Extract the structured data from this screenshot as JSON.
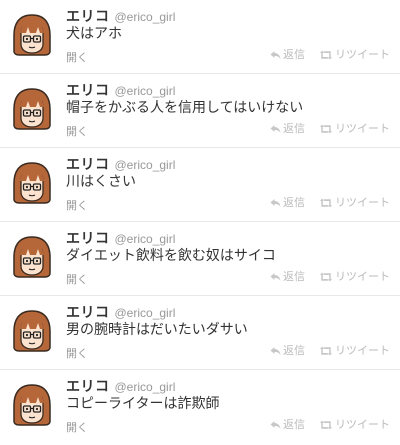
{
  "timeline": {
    "tweets": [
      {
        "name": "エリコ",
        "handle": "@erico_girl",
        "text": "犬はアホ",
        "open_label": "開く",
        "reply_label": "返信",
        "retweet_label": "リツイート"
      },
      {
        "name": "エリコ",
        "handle": "@erico_girl",
        "text": "帽子をかぶる人を信用してはいけない",
        "open_label": "開く",
        "reply_label": "返信",
        "retweet_label": "リツイート"
      },
      {
        "name": "エリコ",
        "handle": "@erico_girl",
        "text": "川はくさい",
        "open_label": "開く",
        "reply_label": "返信",
        "retweet_label": "リツイート"
      },
      {
        "name": "エリコ",
        "handle": "@erico_girl",
        "text": "ダイエット飲料を飲む奴はサイコ",
        "open_label": "開く",
        "reply_label": "返信",
        "retweet_label": "リツイート"
      },
      {
        "name": "エリコ",
        "handle": "@erico_girl",
        "text": "男の腕時計はだいたいダサい",
        "open_label": "開く",
        "reply_label": "返信",
        "retweet_label": "リツイート"
      },
      {
        "name": "エリコ",
        "handle": "@erico_girl",
        "text": "コピーライターは詐欺師",
        "open_label": "開く",
        "reply_label": "返信",
        "retweet_label": "リツイート"
      }
    ]
  },
  "colors": {
    "hair": "#b5673a",
    "skin": "#fbe3cf",
    "muted_text": "#999999",
    "action_text": "#bbbbbb"
  },
  "icons": {
    "avatar": "girl-avatar-icon",
    "reply": "reply-arrow-icon",
    "retweet": "retweet-icon"
  }
}
